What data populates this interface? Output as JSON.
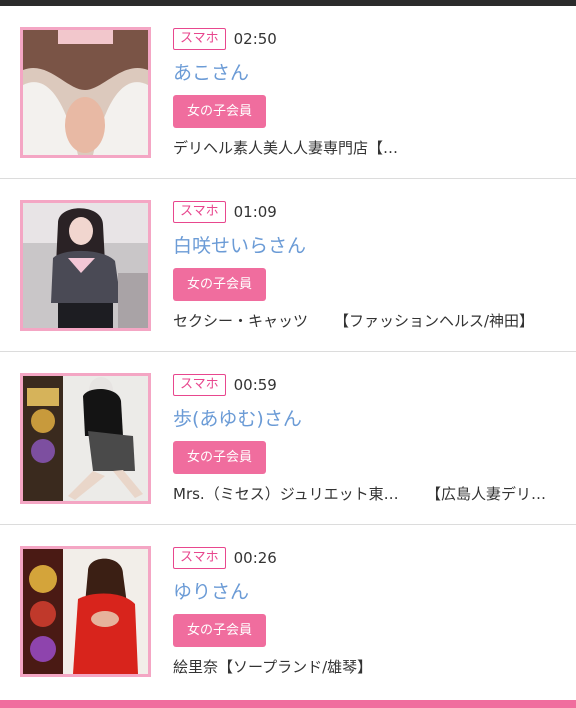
{
  "items": [
    {
      "device": "スマホ",
      "time": "02:50",
      "name": "あこさん",
      "member_label": "女の子会員",
      "shop": "デリヘル素人美人人妻専門店【デリヘル/善通寺】",
      "shop_extra": ""
    },
    {
      "device": "スマホ",
      "time": "01:09",
      "name": "白咲せいらさん",
      "member_label": "女の子会員",
      "shop": "セクシー・キャッツ",
      "shop_extra": "【ファッションヘルス/神田】"
    },
    {
      "device": "スマホ",
      "time": "00:59",
      "name": "歩(あゆむ)さん",
      "member_label": "女の子会員",
      "shop": "Mrs.（ミセス）ジュリエット東広島",
      "shop_extra": "【広島人妻デリヘル】"
    },
    {
      "device": "スマホ",
      "time": "00:26",
      "name": "ゆりさん",
      "member_label": "女の子会員",
      "shop": "絵里奈【ソープランド/雄琴】",
      "shop_extra": ""
    }
  ],
  "theme": {
    "accent": "#e8478e",
    "pill": "#f06d9e",
    "name_color": "#6b9bd6",
    "frame": "#f4a6c4"
  }
}
